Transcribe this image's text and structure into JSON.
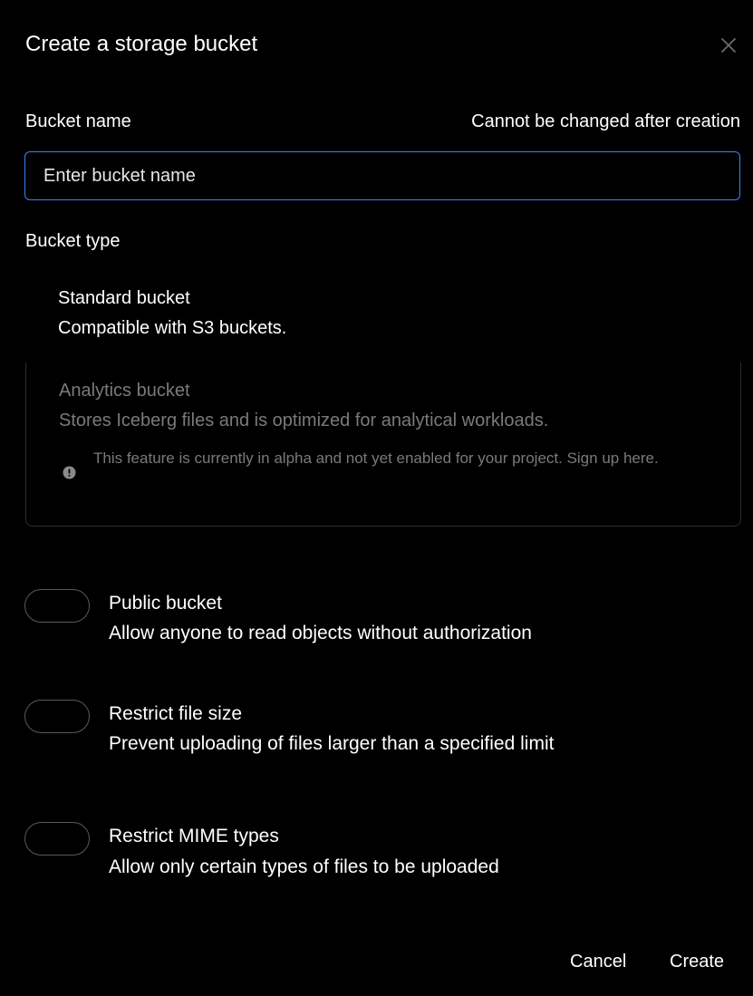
{
  "dialog": {
    "title": "Create a storage bucket"
  },
  "bucket_name": {
    "label": "Bucket name",
    "hint": "Cannot be changed after creation",
    "value": "",
    "placeholder": "Enter bucket name"
  },
  "bucket_type": {
    "label": "Bucket type",
    "options": [
      {
        "title": "Standard bucket",
        "description": "Compatible with S3 buckets.",
        "enabled": true
      },
      {
        "title": "Analytics bucket",
        "description": "Stores Iceberg files and is optimized for analytical workloads.",
        "enabled": false,
        "note_icon": "alert-circle-icon",
        "note": "This feature is currently in alpha and not yet enabled for your project. Sign up here."
      }
    ]
  },
  "settings": [
    {
      "title": "Public bucket",
      "description": "Allow anyone to read objects without authorization",
      "on": false
    },
    {
      "title": "Restrict file size",
      "description": "Prevent uploading of files larger than a specified limit",
      "on": false
    },
    {
      "title": "Restrict MIME types",
      "description": "Allow only certain types of files to be uploaded",
      "on": false
    }
  ],
  "footer": {
    "cancel_label": "Cancel",
    "create_label": "Create"
  },
  "icons": {
    "close": "close-icon",
    "alert": "alert-circle-icon"
  },
  "colors": {
    "background": "#000000",
    "input_focus_border": "#3b82f6",
    "muted_text": "#7a7a7a"
  }
}
